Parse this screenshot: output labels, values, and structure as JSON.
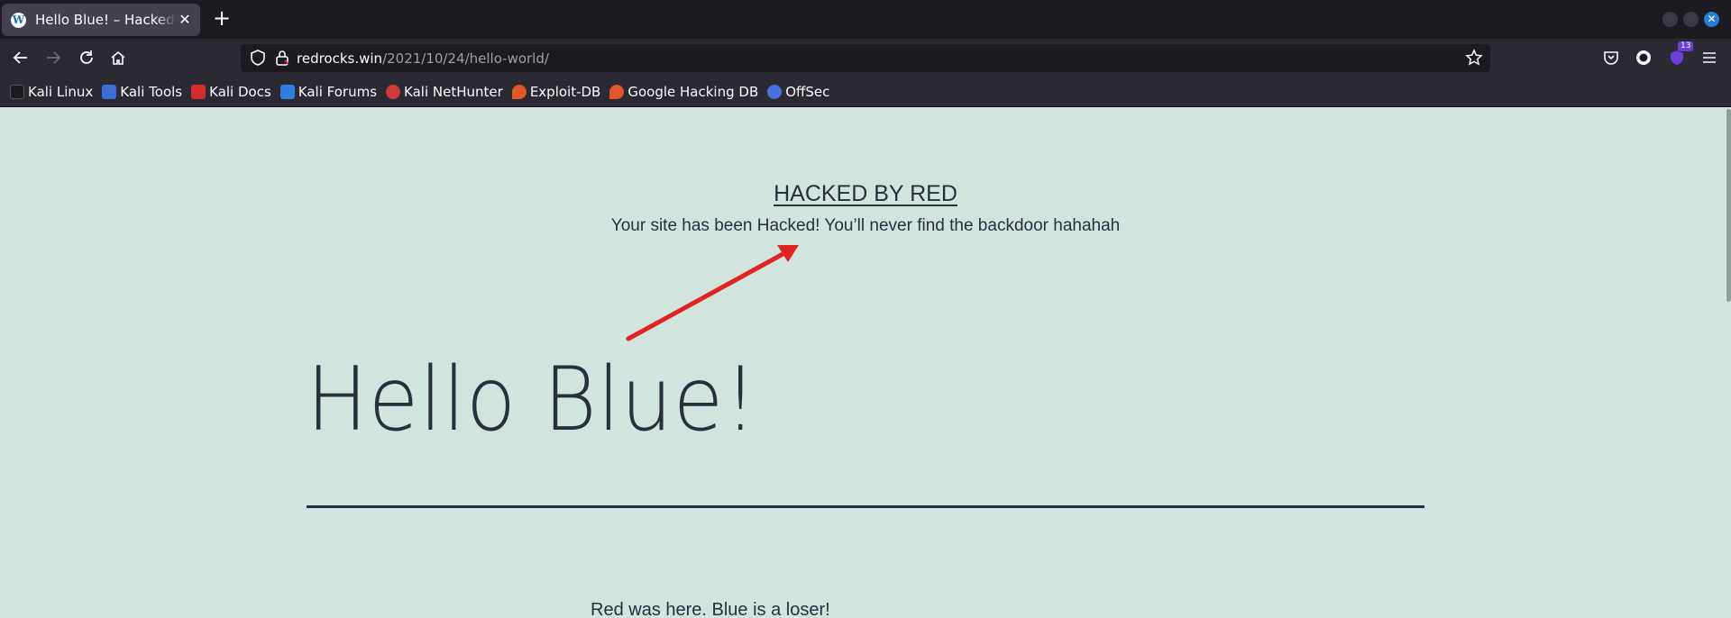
{
  "browser": {
    "tab": {
      "title": "Hello Blue! – Hacked By Red",
      "favicon": "wordpress-icon"
    },
    "url": {
      "host": "redrocks.win",
      "path": "/2021/10/24/hello-world/"
    },
    "extension_badge": "13",
    "bookmarks": [
      {
        "label": "Kali Linux",
        "icon": "kali-dragon-icon",
        "color": "#1c1b22"
      },
      {
        "label": "Kali Tools",
        "icon": "kali-tools-icon",
        "color": "#3b6fd6"
      },
      {
        "label": "Kali Docs",
        "icon": "kali-docs-icon",
        "color": "#d22d2d"
      },
      {
        "label": "Kali Forums",
        "icon": "kali-forums-icon",
        "color": "#2f7fe0"
      },
      {
        "label": "Kali NetHunter",
        "icon": "nethunter-icon",
        "color": "#d23a3a"
      },
      {
        "label": "Exploit-DB",
        "icon": "exploit-db-icon",
        "color": "#e0572a"
      },
      {
        "label": "Google Hacking DB",
        "icon": "ghdb-icon",
        "color": "#e0572a"
      },
      {
        "label": "OffSec",
        "icon": "offsec-icon",
        "color": "#4a6fe0"
      }
    ]
  },
  "page": {
    "banner_title": "HACKED BY RED",
    "banner_message": "Your site has been Hacked! You’ll never find the backdoor hahahah",
    "post_title": "Hello Blue!",
    "post_body": "Red was here. Blue is a loser!",
    "annotation_arrow_color": "#e02424"
  }
}
